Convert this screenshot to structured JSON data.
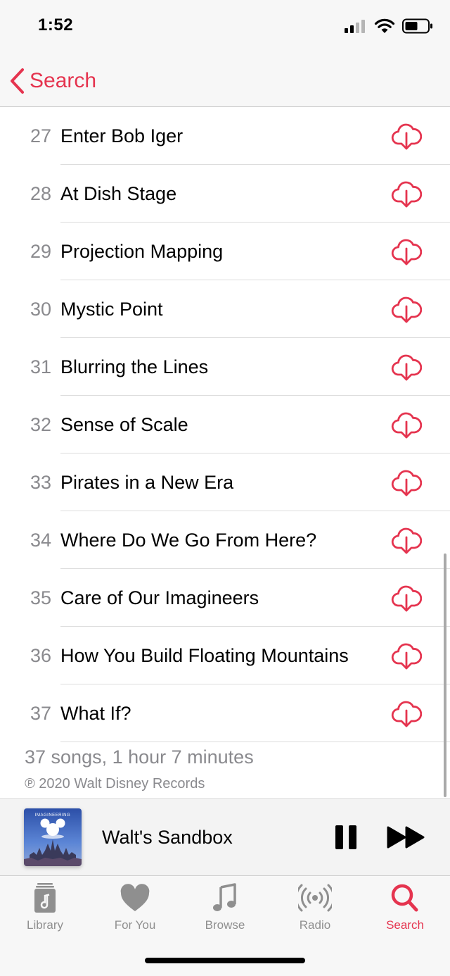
{
  "status": {
    "time": "1:52"
  },
  "nav": {
    "back_label": "Search"
  },
  "tracks": [
    {
      "number": "27",
      "title": "Enter Bob Iger"
    },
    {
      "number": "28",
      "title": "At Dish Stage"
    },
    {
      "number": "29",
      "title": "Projection Mapping"
    },
    {
      "number": "30",
      "title": "Mystic Point"
    },
    {
      "number": "31",
      "title": "Blurring the Lines"
    },
    {
      "number": "32",
      "title": "Sense of Scale"
    },
    {
      "number": "33",
      "title": "Pirates in a New Era"
    },
    {
      "number": "34",
      "title": "Where Do We Go From Here?"
    },
    {
      "number": "35",
      "title": "Care of Our Imagineers"
    },
    {
      "number": "36",
      "title": "How You Build Floating Mountains"
    },
    {
      "number": "37",
      "title": "What If?"
    }
  ],
  "footer": {
    "summary": "37 songs, 1 hour 7 minutes",
    "copyright": "℗ 2020 Walt Disney Records"
  },
  "player": {
    "title": "Walt's Sandbox",
    "album_art_text": "IMAGINEERING"
  },
  "tabs": [
    {
      "label": "Library",
      "icon": "library-icon",
      "active": false
    },
    {
      "label": "For You",
      "icon": "heart-icon",
      "active": false
    },
    {
      "label": "Browse",
      "icon": "music-note-icon",
      "active": false
    },
    {
      "label": "Radio",
      "icon": "radio-icon",
      "active": false
    },
    {
      "label": "Search",
      "icon": "search-icon",
      "active": true
    }
  ],
  "colors": {
    "accent": "#e5344f",
    "secondary_text": "#8a8a8e",
    "tab_inactive": "#8f8f8f"
  }
}
